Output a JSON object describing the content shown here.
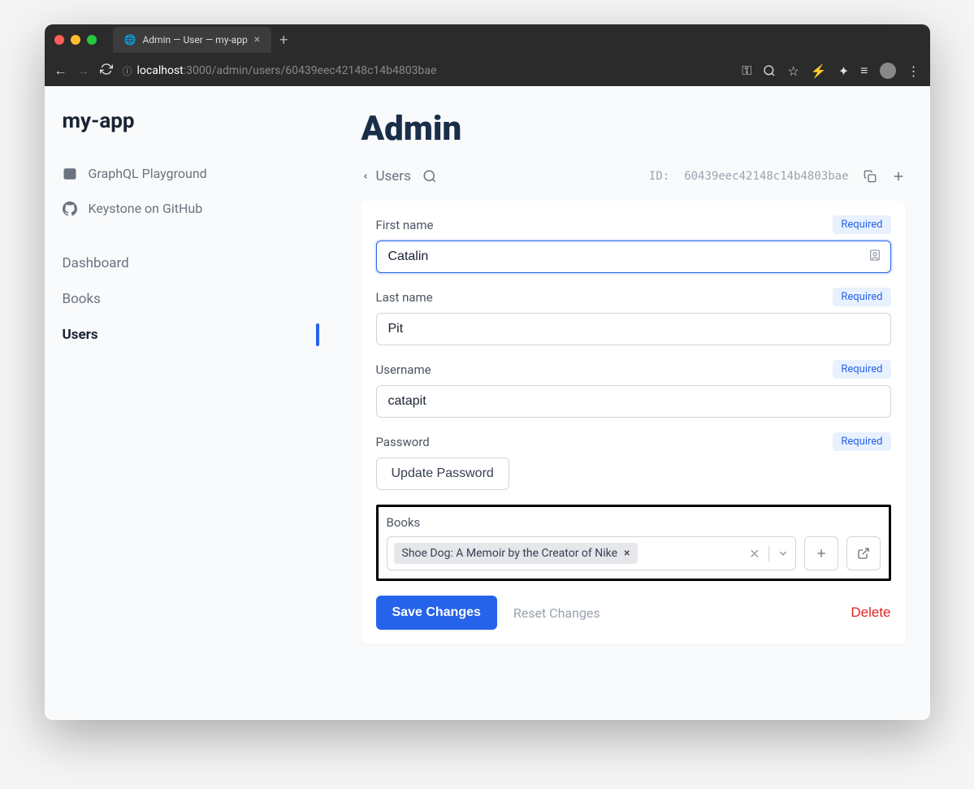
{
  "browser": {
    "tab_title": "Admin — User — my-app",
    "url_host": "localhost",
    "url_path": ":3000/admin/users/60439eec42148c14b4803bae"
  },
  "sidebar": {
    "app_title": "my-app",
    "ext_links": [
      "GraphQL Playground",
      "Keystone on GitHub"
    ],
    "nav_items": [
      {
        "label": "Dashboard",
        "active": false
      },
      {
        "label": "Books",
        "active": false
      },
      {
        "label": "Users",
        "active": true
      }
    ]
  },
  "page": {
    "heading": "Admin",
    "breadcrumb_back": "Users",
    "id_label": "ID:",
    "id_value": "60439eec42148c14b4803bae"
  },
  "form": {
    "first_name": {
      "label": "First name",
      "value": "Catalin",
      "required": "Required"
    },
    "last_name": {
      "label": "Last name",
      "value": "Pit",
      "required": "Required"
    },
    "username": {
      "label": "Username",
      "value": "catapit",
      "required": "Required"
    },
    "password": {
      "label": "Password",
      "required": "Required",
      "button": "Update Password"
    },
    "books": {
      "label": "Books",
      "selected": [
        "Shoe Dog: A Memoir by the Creator of Nike"
      ]
    }
  },
  "actions": {
    "save": "Save Changes",
    "reset": "Reset Changes",
    "delete": "Delete"
  }
}
